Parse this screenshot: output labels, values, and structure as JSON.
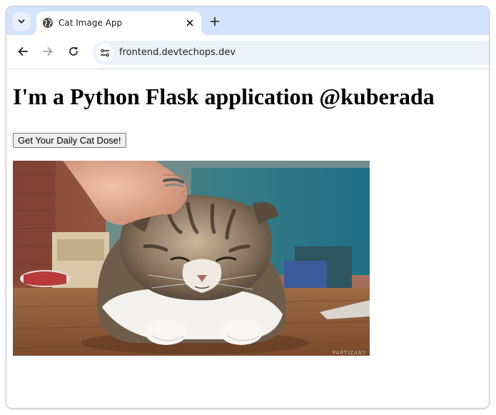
{
  "browser": {
    "tab": {
      "title": "Cat Image App"
    },
    "address_bar": {
      "url": "frontend.devtechops.dev"
    }
  },
  "page": {
    "heading": "I'm a Python Flask application @kuberada",
    "button_label": "Get Your Daily Cat Dose!",
    "image": {
      "subject": "cat-photo",
      "watermark": "PARTIZANY"
    }
  },
  "icons": {
    "tab_search": "chevron-down-icon",
    "favicon": "globe-icon",
    "close": "close-icon",
    "new_tab": "plus-icon",
    "back": "arrow-left-icon",
    "forward": "arrow-right-icon",
    "reload": "reload-icon",
    "site_info": "tune-icon"
  },
  "colors": {
    "tabstrip": "#d3e3fd",
    "omnibox": "#edf1fa"
  }
}
